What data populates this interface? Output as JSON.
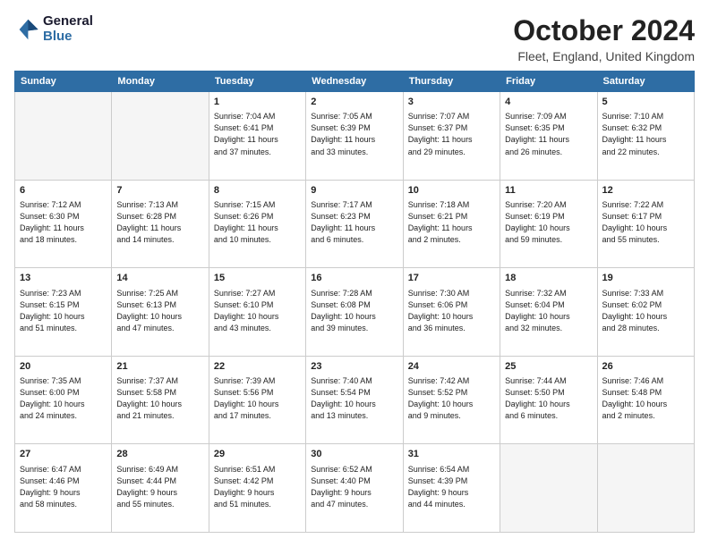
{
  "header": {
    "logo_line1": "General",
    "logo_line2": "Blue",
    "month": "October 2024",
    "location": "Fleet, England, United Kingdom"
  },
  "days_of_week": [
    "Sunday",
    "Monday",
    "Tuesday",
    "Wednesday",
    "Thursday",
    "Friday",
    "Saturday"
  ],
  "weeks": [
    [
      {
        "day": "",
        "info": ""
      },
      {
        "day": "",
        "info": ""
      },
      {
        "day": "1",
        "info": "Sunrise: 7:04 AM\nSunset: 6:41 PM\nDaylight: 11 hours\nand 37 minutes."
      },
      {
        "day": "2",
        "info": "Sunrise: 7:05 AM\nSunset: 6:39 PM\nDaylight: 11 hours\nand 33 minutes."
      },
      {
        "day": "3",
        "info": "Sunrise: 7:07 AM\nSunset: 6:37 PM\nDaylight: 11 hours\nand 29 minutes."
      },
      {
        "day": "4",
        "info": "Sunrise: 7:09 AM\nSunset: 6:35 PM\nDaylight: 11 hours\nand 26 minutes."
      },
      {
        "day": "5",
        "info": "Sunrise: 7:10 AM\nSunset: 6:32 PM\nDaylight: 11 hours\nand 22 minutes."
      }
    ],
    [
      {
        "day": "6",
        "info": "Sunrise: 7:12 AM\nSunset: 6:30 PM\nDaylight: 11 hours\nand 18 minutes."
      },
      {
        "day": "7",
        "info": "Sunrise: 7:13 AM\nSunset: 6:28 PM\nDaylight: 11 hours\nand 14 minutes."
      },
      {
        "day": "8",
        "info": "Sunrise: 7:15 AM\nSunset: 6:26 PM\nDaylight: 11 hours\nand 10 minutes."
      },
      {
        "day": "9",
        "info": "Sunrise: 7:17 AM\nSunset: 6:23 PM\nDaylight: 11 hours\nand 6 minutes."
      },
      {
        "day": "10",
        "info": "Sunrise: 7:18 AM\nSunset: 6:21 PM\nDaylight: 11 hours\nand 2 minutes."
      },
      {
        "day": "11",
        "info": "Sunrise: 7:20 AM\nSunset: 6:19 PM\nDaylight: 10 hours\nand 59 minutes."
      },
      {
        "day": "12",
        "info": "Sunrise: 7:22 AM\nSunset: 6:17 PM\nDaylight: 10 hours\nand 55 minutes."
      }
    ],
    [
      {
        "day": "13",
        "info": "Sunrise: 7:23 AM\nSunset: 6:15 PM\nDaylight: 10 hours\nand 51 minutes."
      },
      {
        "day": "14",
        "info": "Sunrise: 7:25 AM\nSunset: 6:13 PM\nDaylight: 10 hours\nand 47 minutes."
      },
      {
        "day": "15",
        "info": "Sunrise: 7:27 AM\nSunset: 6:10 PM\nDaylight: 10 hours\nand 43 minutes."
      },
      {
        "day": "16",
        "info": "Sunrise: 7:28 AM\nSunset: 6:08 PM\nDaylight: 10 hours\nand 39 minutes."
      },
      {
        "day": "17",
        "info": "Sunrise: 7:30 AM\nSunset: 6:06 PM\nDaylight: 10 hours\nand 36 minutes."
      },
      {
        "day": "18",
        "info": "Sunrise: 7:32 AM\nSunset: 6:04 PM\nDaylight: 10 hours\nand 32 minutes."
      },
      {
        "day": "19",
        "info": "Sunrise: 7:33 AM\nSunset: 6:02 PM\nDaylight: 10 hours\nand 28 minutes."
      }
    ],
    [
      {
        "day": "20",
        "info": "Sunrise: 7:35 AM\nSunset: 6:00 PM\nDaylight: 10 hours\nand 24 minutes."
      },
      {
        "day": "21",
        "info": "Sunrise: 7:37 AM\nSunset: 5:58 PM\nDaylight: 10 hours\nand 21 minutes."
      },
      {
        "day": "22",
        "info": "Sunrise: 7:39 AM\nSunset: 5:56 PM\nDaylight: 10 hours\nand 17 minutes."
      },
      {
        "day": "23",
        "info": "Sunrise: 7:40 AM\nSunset: 5:54 PM\nDaylight: 10 hours\nand 13 minutes."
      },
      {
        "day": "24",
        "info": "Sunrise: 7:42 AM\nSunset: 5:52 PM\nDaylight: 10 hours\nand 9 minutes."
      },
      {
        "day": "25",
        "info": "Sunrise: 7:44 AM\nSunset: 5:50 PM\nDaylight: 10 hours\nand 6 minutes."
      },
      {
        "day": "26",
        "info": "Sunrise: 7:46 AM\nSunset: 5:48 PM\nDaylight: 10 hours\nand 2 minutes."
      }
    ],
    [
      {
        "day": "27",
        "info": "Sunrise: 6:47 AM\nSunset: 4:46 PM\nDaylight: 9 hours\nand 58 minutes."
      },
      {
        "day": "28",
        "info": "Sunrise: 6:49 AM\nSunset: 4:44 PM\nDaylight: 9 hours\nand 55 minutes."
      },
      {
        "day": "29",
        "info": "Sunrise: 6:51 AM\nSunset: 4:42 PM\nDaylight: 9 hours\nand 51 minutes."
      },
      {
        "day": "30",
        "info": "Sunrise: 6:52 AM\nSunset: 4:40 PM\nDaylight: 9 hours\nand 47 minutes."
      },
      {
        "day": "31",
        "info": "Sunrise: 6:54 AM\nSunset: 4:39 PM\nDaylight: 9 hours\nand 44 minutes."
      },
      {
        "day": "",
        "info": ""
      },
      {
        "day": "",
        "info": ""
      }
    ]
  ]
}
